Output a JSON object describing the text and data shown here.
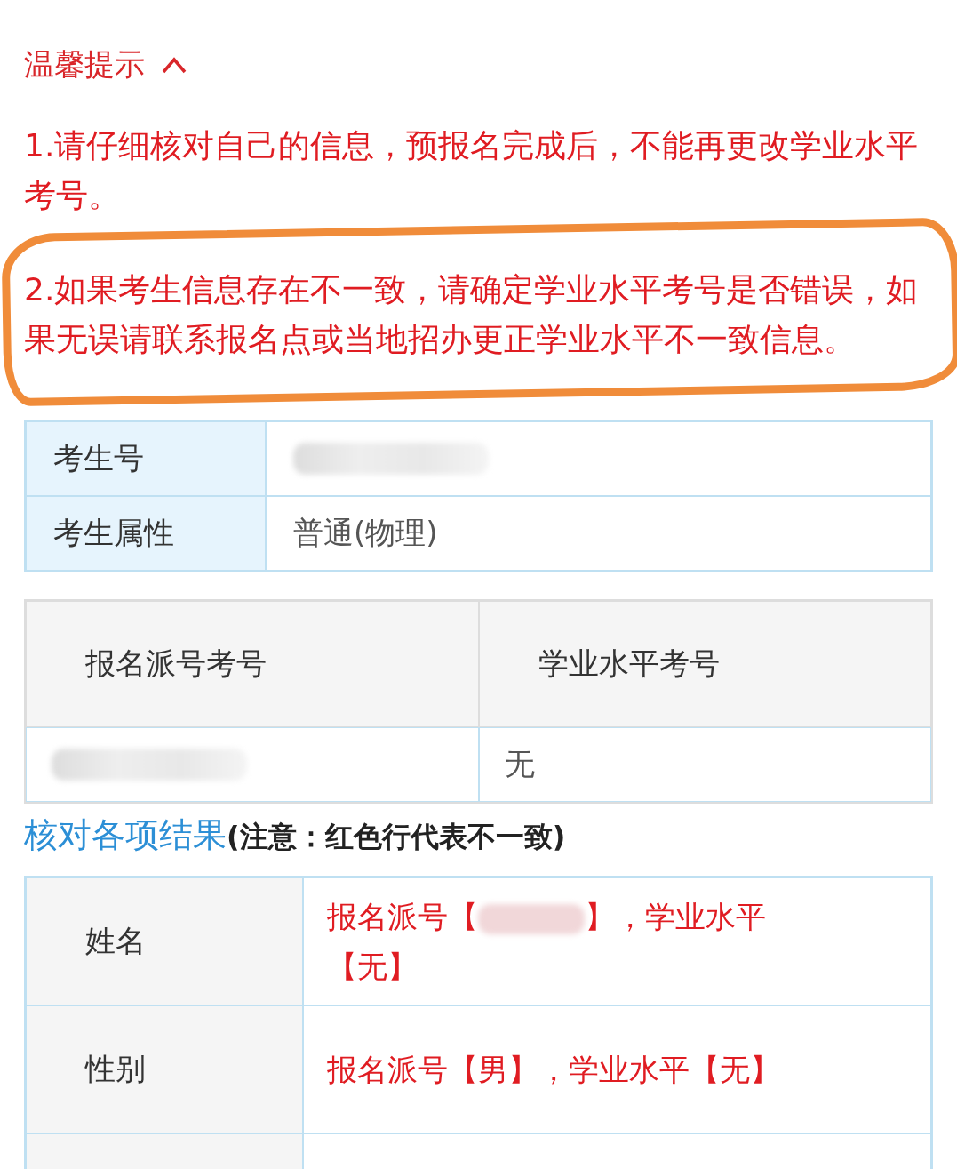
{
  "notice": {
    "title": "温馨提示",
    "expanded": true,
    "items": [
      {
        "text": "1.请仔细核对自己的信息，预报名完成后，不能再更改学业水平考号。",
        "highlighted": false
      },
      {
        "text": "2.如果考生信息存在不一致，请确定学业水平考号是否错误，如果无误请联系报名点或当地招办更正学业水平不一致信息。",
        "highlighted": true
      }
    ]
  },
  "student_table": {
    "rows": [
      {
        "label": "考生号",
        "redacted": true
      },
      {
        "label": "考生属性",
        "value": "普通(物理)",
        "redacted": false
      }
    ]
  },
  "number_table": {
    "columns": [
      "报名派号考号",
      "学业水平考号"
    ],
    "rows": [
      [
        {
          "redacted": true
        },
        {
          "value": "无",
          "redacted": false
        }
      ]
    ]
  },
  "results": {
    "title": "核对各项结果",
    "note": "(注意：红色行代表不一致)",
    "rows": [
      {
        "label": "姓名",
        "mismatch": true,
        "segments": [
          {
            "kind": "text",
            "text": "报名派号【"
          },
          {
            "kind": "redacted"
          },
          {
            "kind": "text",
            "text": "】，学业水平【无】"
          }
        ]
      },
      {
        "label": "性别",
        "mismatch": true,
        "segments": [
          {
            "kind": "text",
            "text": "报名派号【男】，学业水平【无】"
          }
        ]
      }
    ]
  }
}
